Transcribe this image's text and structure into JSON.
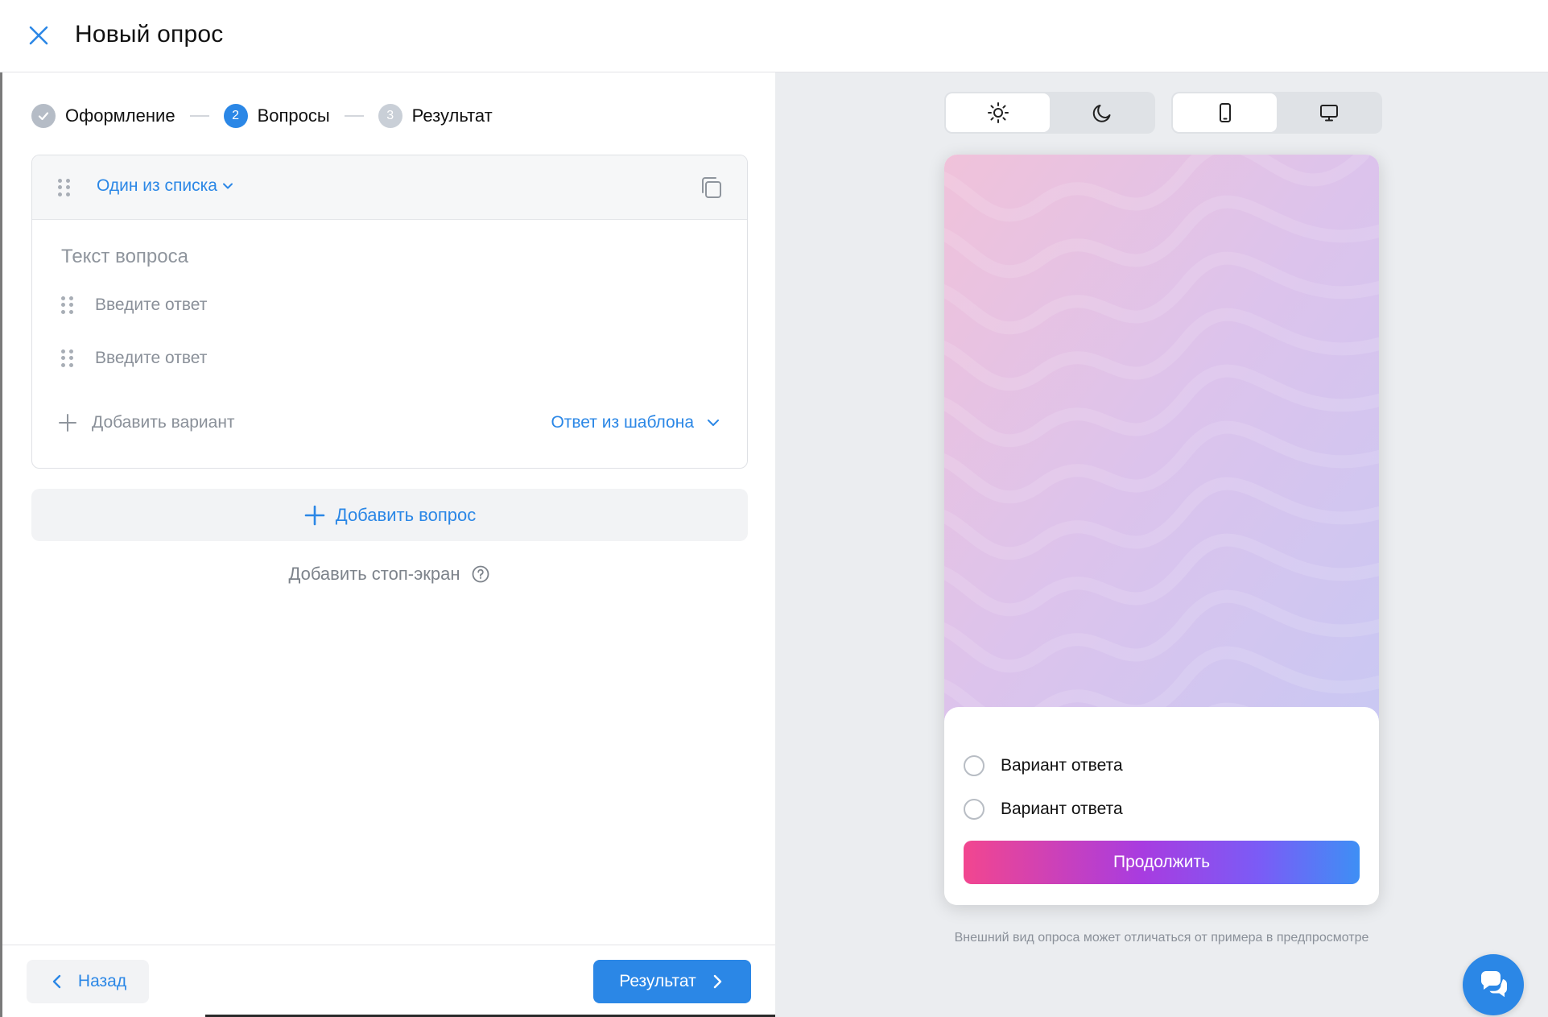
{
  "header": {
    "title": "Новый опрос"
  },
  "stepper": {
    "steps": [
      {
        "number": "",
        "label": "Оформление",
        "state": "done"
      },
      {
        "number": "2",
        "label": "Вопросы",
        "state": "active"
      },
      {
        "number": "3",
        "label": "Результат",
        "state": "pending"
      }
    ]
  },
  "question": {
    "type_label": "Один из списка",
    "text_placeholder": "Текст вопроса",
    "answers": [
      "Введите ответ",
      "Введите ответ"
    ],
    "add_variant_label": "Добавить вариант",
    "template_label": "Ответ из шаблона"
  },
  "add_question_label": "Добавить вопрос",
  "stop_screen_label": "Добавить стоп-экран",
  "footer": {
    "back_label": "Назад",
    "next_label": "Результат"
  },
  "preview": {
    "theme_options": [
      "light-theme-icon",
      "dark-theme-icon"
    ],
    "theme_selected": "light",
    "device_options": [
      "mobile-icon",
      "desktop-icon"
    ],
    "device_selected": "mobile",
    "answer_options": [
      "Вариант ответа",
      "Вариант ответа"
    ],
    "continue_label": "Продолжить",
    "note": "Внешний вид опроса может отличаться от примера в предпросмотре"
  },
  "colors": {
    "accent": "#2b87e6",
    "panel_bg": "#ebedf0",
    "gradient_start": "#f2468f",
    "gradient_end": "#3e8ff5"
  }
}
